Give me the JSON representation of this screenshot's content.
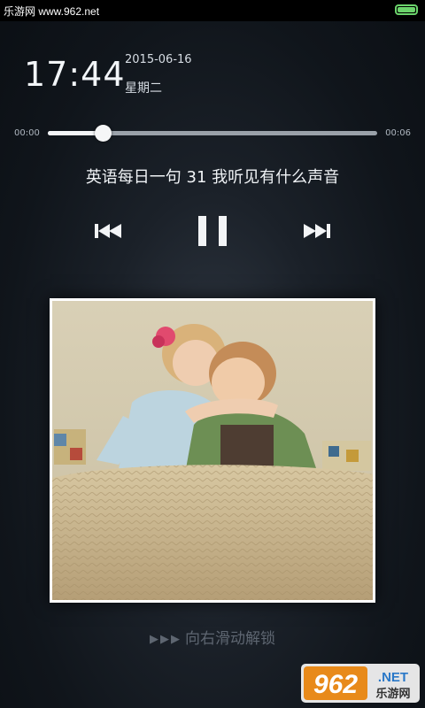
{
  "status_bar": {
    "watermark_text": "乐游网 www.962.net",
    "battery_level": 1.0,
    "battery_color": "#6bd36b"
  },
  "clock": {
    "time": "17:44",
    "date": "2015-06-16",
    "weekday": "星期二"
  },
  "player": {
    "elapsed": "00:00",
    "total": "00:06",
    "progress": 0.17,
    "title": "英语每日一句 31 我听见有什么声音",
    "controls": {
      "prev_icon": "skip-previous-icon",
      "pause_icon": "pause-icon",
      "next_icon": "skip-next-icon"
    }
  },
  "album": {
    "description_icon": "album-art-image"
  },
  "unlock": {
    "arrows": "▶▶▶",
    "label": "向右滑动解锁"
  },
  "logo": {
    "text_main": "962",
    "text_suffix": ".NET",
    "text_sub": "乐游网"
  }
}
